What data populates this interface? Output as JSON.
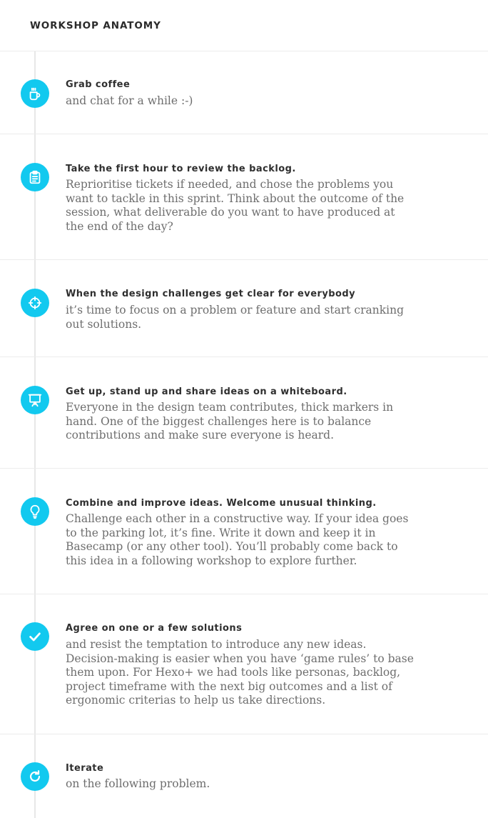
{
  "page": {
    "title": "WORKSHOP ANATOMY"
  },
  "colors": {
    "accent": "#12c9ef",
    "title_text": "#2f2f2f",
    "body_text": "#6e6e6e",
    "divider": "#ececec"
  },
  "steps": [
    {
      "icon": "coffee-mug-icon",
      "title": "Grab coffee",
      "body": "and chat for a while :-)"
    },
    {
      "icon": "clipboard-icon",
      "title": "Take the first hour to review the backlog.",
      "body": "Reprioritise tickets if needed, and chose the problems you want to tackle in this sprint. Think about the outcome of the session, what deliverable do you want to have produced at the end of the day?"
    },
    {
      "icon": "crosshair-target-icon",
      "title": "When the design challenges get clear for everybody",
      "body": "it’s time to focus on a problem or feature and start cranking out solutions."
    },
    {
      "icon": "whiteboard-presentation-icon",
      "title": "Get up, stand up and share ideas on a whiteboard.",
      "body": "Everyone in the design team contributes, thick markers in hand. One of the biggest challenges here is to balance contributions and make sure everyone is heard."
    },
    {
      "icon": "lightbulb-icon",
      "title": "Combine and improve ideas. Welcome unusual thinking.",
      "body": "Challenge each other in a constructive way. If your idea goes to the parking lot, it’s fine. Write it down and keep it in Basecamp (or any other tool). You’ll probably come back to this idea in a following workshop to explore further."
    },
    {
      "icon": "checkmark-icon",
      "title": "Agree on one or a few solutions",
      "body": "and resist the temptation to introduce any new ideas. Decision-making is easier when you have ‘game rules’ to base them upon. For Hexo+ we had tools like personas, backlog, project timeframe with the next big outcomes and a list of ergonomic criterias to help us take directions."
    },
    {
      "icon": "refresh-arrow-icon",
      "title": "Iterate",
      "body": "on the following problem."
    }
  ]
}
